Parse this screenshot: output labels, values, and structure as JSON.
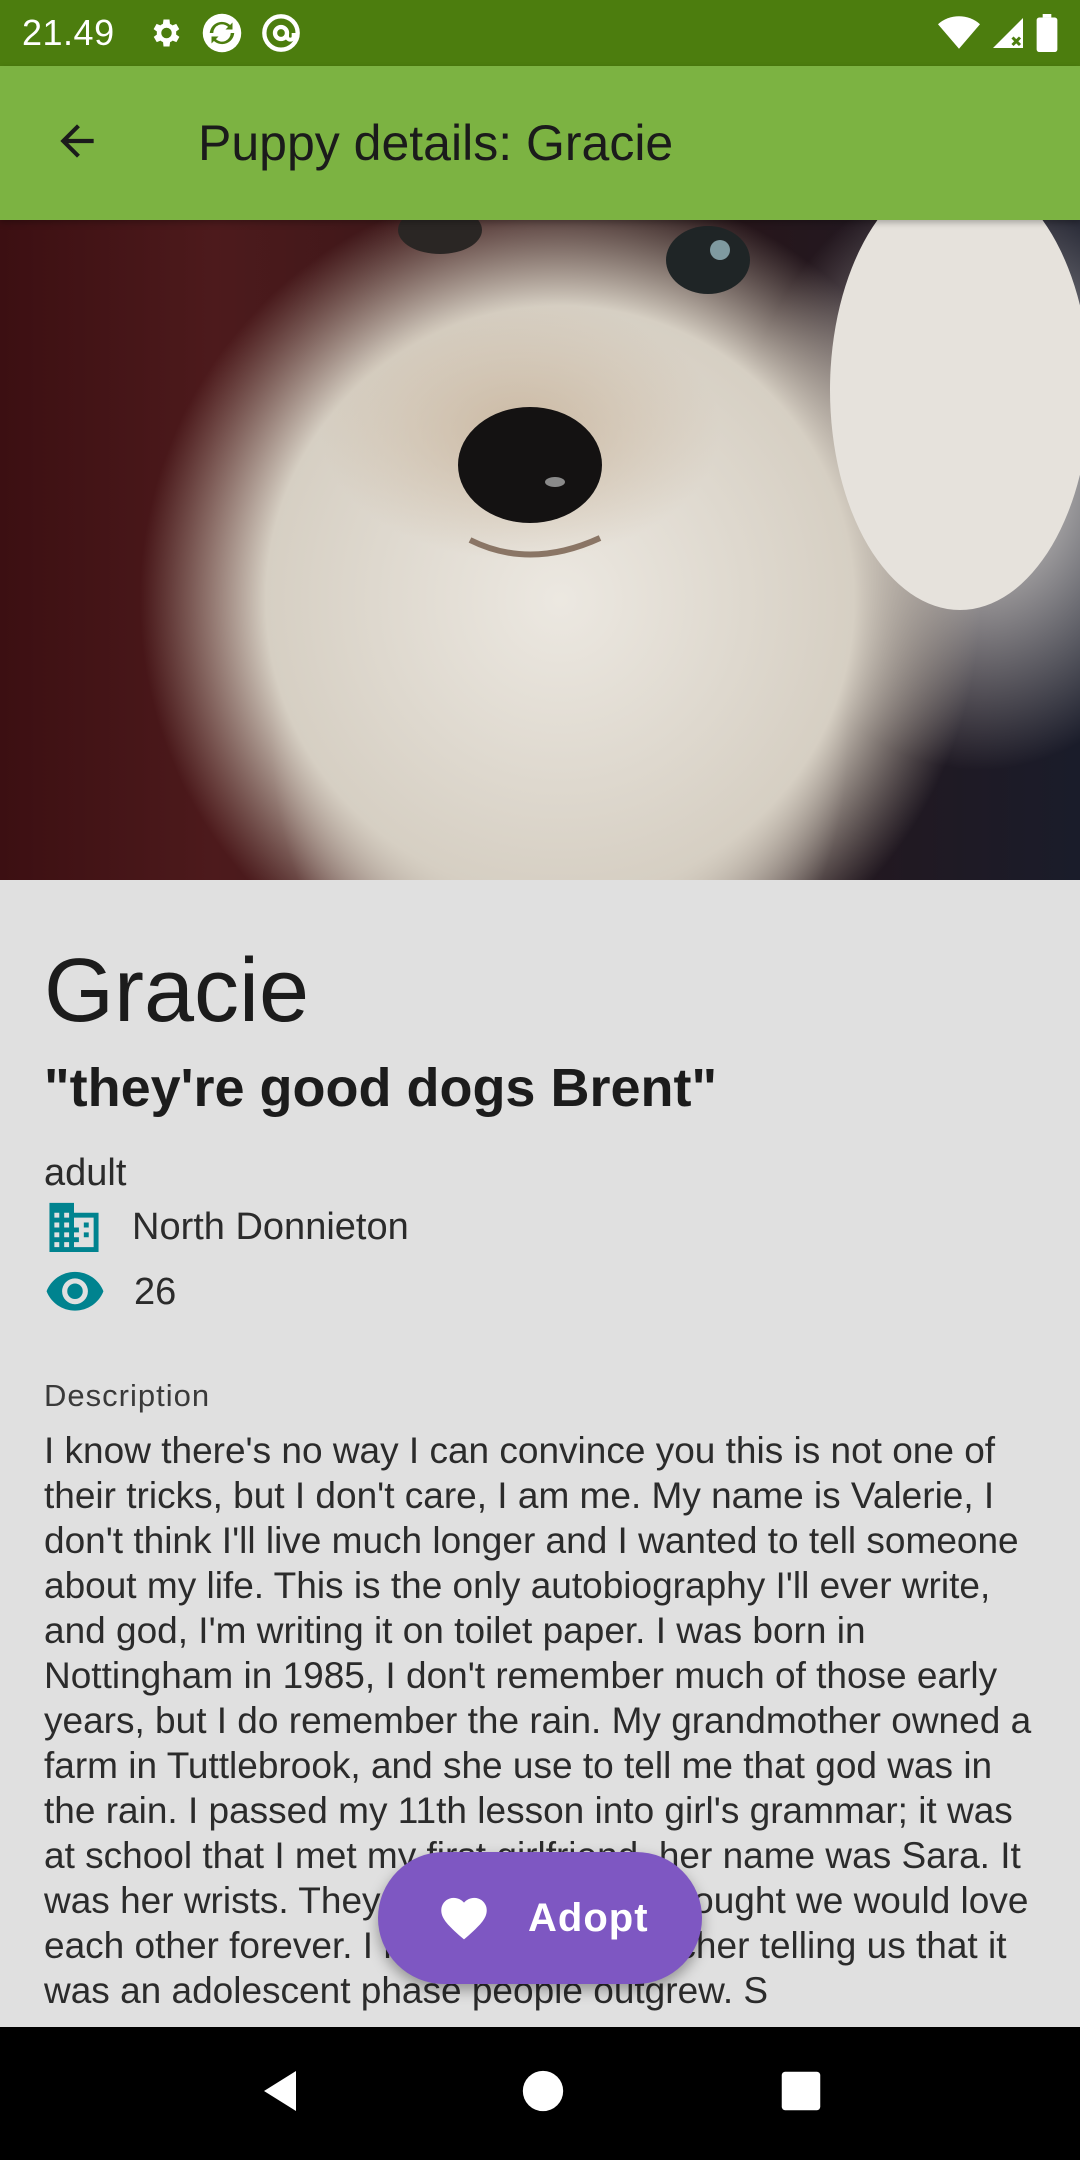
{
  "status_bar": {
    "time": "21.49",
    "icons_left": [
      "gear-icon",
      "sync-icon",
      "at-icon"
    ],
    "icons_right": [
      "wifi-icon",
      "cellular-icon",
      "battery-icon"
    ]
  },
  "app_bar": {
    "back_icon": "arrow-back-icon",
    "title": "Puppy details: Gracie",
    "background": "#7cb342"
  },
  "puppy": {
    "name": "Gracie",
    "tagline": "\"they're good dogs Brent\"",
    "age": "adult",
    "location": "North Donnieton",
    "views": "26",
    "location_icon": "building-icon",
    "views_icon": "eye-icon"
  },
  "description": {
    "label": "Description",
    "text": "I know there's no way I can convince you this is not one of their tricks, but I don't care, I am me. My name is Valerie, I don't think I'll live much longer and I wanted to tell someone about my life. This is the only autobiography I'll ever write, and god, I'm writing it on toilet paper. I was born in Nottingham in 1985, I don't remember much of those early years, but I do remember the rain. My grandmother owned a farm in Tuttlebrook, and she use to tell me that god was in the rain. I passed my 11th lesson into girl's grammar; it was at school that I met my first girlfriend, her name was Sara. It was her wrists. They were beautiful. I thought we would love each other forever. I remember our teacher telling us that it was an adolescent phase people outgrew. S"
  },
  "fab": {
    "label": "Adopt",
    "icon": "heart-icon",
    "color": "#7e57c2"
  },
  "nav_bar": {
    "buttons": [
      "back-triangle-icon",
      "home-circle-icon",
      "recents-square-icon"
    ]
  },
  "colors": {
    "status_bar": "#4c7d0e",
    "icon_teal": "#00838f",
    "content_bg": "#e0e0e0"
  }
}
